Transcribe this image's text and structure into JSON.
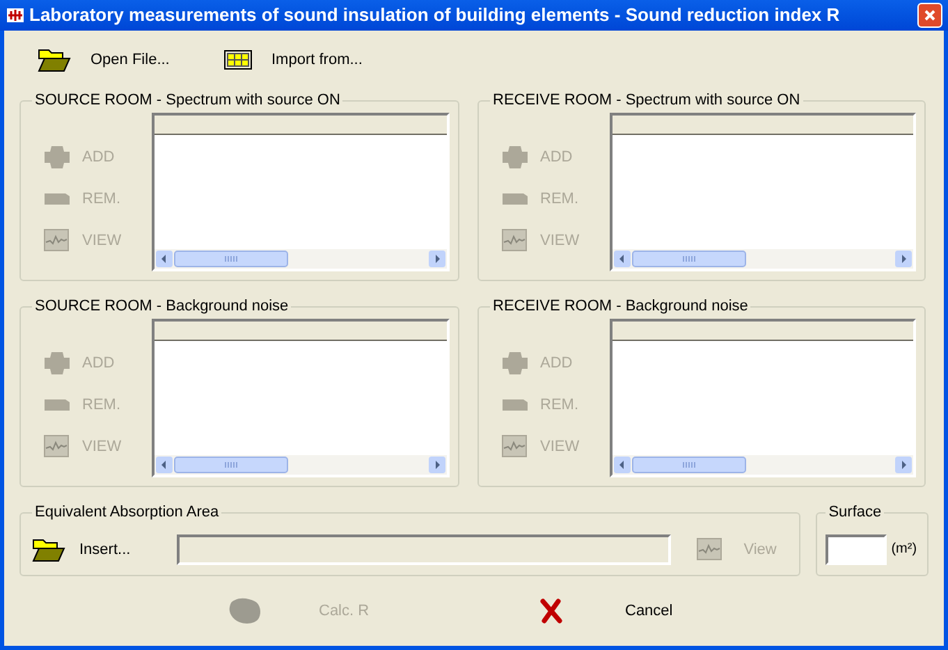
{
  "window": {
    "title": "Laboratory measurements of sound insulation of building elements - Sound reduction index R"
  },
  "toolbar": [
    {
      "label": "Open File...",
      "kind": "folder"
    },
    {
      "label": "Import from...",
      "kind": "grid"
    }
  ],
  "panels": [
    {
      "title": "SOURCE ROOM - Spectrum with source ON",
      "buttons": [
        {
          "label": "ADD",
          "kind": "add",
          "disabled": true
        },
        {
          "label": "REM.",
          "kind": "remove",
          "disabled": true
        },
        {
          "label": "VIEW",
          "kind": "view",
          "disabled": true
        }
      ]
    },
    {
      "title": "RECEIVE ROOM - Spectrum with source ON",
      "buttons": [
        {
          "label": "ADD",
          "kind": "add",
          "disabled": true
        },
        {
          "label": "REM.",
          "kind": "remove",
          "disabled": true
        },
        {
          "label": "VIEW",
          "kind": "view",
          "disabled": true
        }
      ]
    },
    {
      "title": "SOURCE ROOM - Background noise",
      "buttons": [
        {
          "label": "ADD",
          "kind": "add",
          "disabled": true
        },
        {
          "label": "REM.",
          "kind": "remove",
          "disabled": true
        },
        {
          "label": "VIEW",
          "kind": "view",
          "disabled": true
        }
      ]
    },
    {
      "title": "RECEIVE ROOM - Background noise",
      "buttons": [
        {
          "label": "ADD",
          "kind": "add",
          "disabled": true
        },
        {
          "label": "REM.",
          "kind": "remove",
          "disabled": true
        },
        {
          "label": "VIEW",
          "kind": "view",
          "disabled": true
        }
      ]
    }
  ],
  "absorption": {
    "title": "Equivalent Absorption Area",
    "insert": {
      "label": "Insert...",
      "kind": "folder",
      "disabled": false
    },
    "view": {
      "label": "View",
      "kind": "view",
      "disabled": true
    }
  },
  "surface": {
    "title": "Surface",
    "unit": "(m²)"
  },
  "actions": [
    {
      "label": "Calc. R",
      "kind": "calc",
      "disabled": true
    },
    {
      "label": "Cancel",
      "kind": "cancel",
      "disabled": false
    }
  ]
}
